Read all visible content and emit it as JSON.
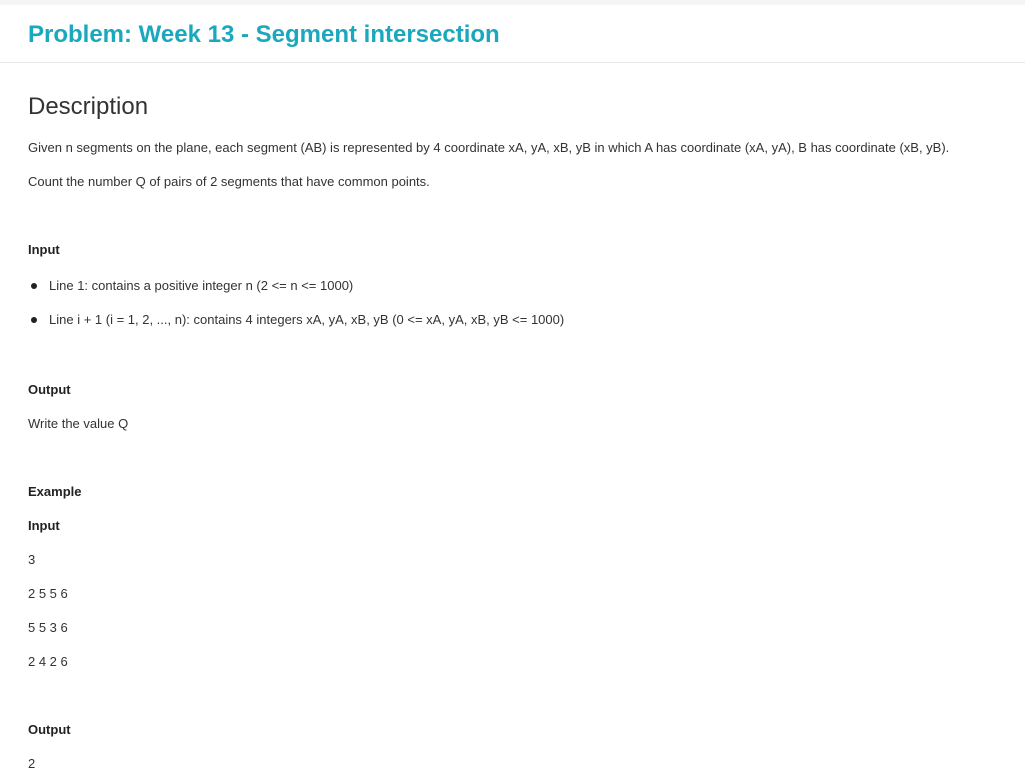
{
  "header": {
    "title": "Problem: Week 13 - Segment intersection"
  },
  "description": {
    "heading": "Description",
    "paragraphs": [
      "Given n segments on the plane, each segment (AB) is represented by 4 coordinate xA, yA, xB, yB in which A has coordinate (xA, yA), B has coordinate (xB, yB).",
      "Count the number Q of pairs of 2 segments that have common points."
    ]
  },
  "input_section": {
    "heading": "Input",
    "items": [
      "Line 1: contains a positive integer n (2 <= n <= 1000)",
      "Line i + 1 (i = 1, 2, ..., n): contains 4 integers xA, yA, xB, yB (0 <= xA, yA, xB, yB <= 1000)"
    ]
  },
  "output_section": {
    "heading": "Output",
    "text": "Write the value Q"
  },
  "example": {
    "heading": "Example",
    "input_label": "Input",
    "input_lines": [
      "3",
      "2 5 5 6",
      "5 5 3 6",
      "2 4 2 6"
    ],
    "output_label": "Output",
    "output_lines": [
      "2"
    ]
  }
}
